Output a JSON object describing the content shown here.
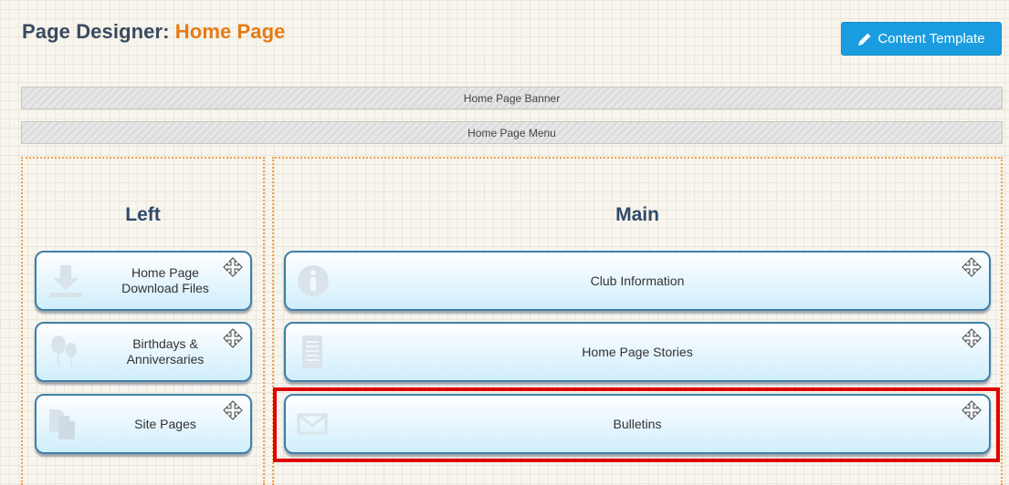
{
  "header": {
    "title_prefix": "Page Designer:",
    "page_name": "Home Page",
    "content_template_label": "Content Template"
  },
  "strips": {
    "banner": "Home Page Banner",
    "menu": "Home Page Menu"
  },
  "left": {
    "heading": "Left",
    "widgets": [
      {
        "label": "Home Page Download Files",
        "icon": "download-icon"
      },
      {
        "label": "Birthdays & Anniversaries",
        "icon": "balloons-icon"
      },
      {
        "label": "Site Pages",
        "icon": "pages-icon"
      }
    ]
  },
  "main": {
    "heading": "Main",
    "widgets": [
      {
        "label": "Club Information",
        "icon": "info-icon"
      },
      {
        "label": "Home Page Stories",
        "icon": "document-icon"
      },
      {
        "label": "Bulletins",
        "icon": "envelope-icon",
        "selected": true
      }
    ]
  },
  "colors": {
    "title": "#3a4a5e",
    "page_name": "#e67a12",
    "button": "#1a9de0",
    "zone_border": "#f0a04b",
    "selection": "#e00000"
  }
}
